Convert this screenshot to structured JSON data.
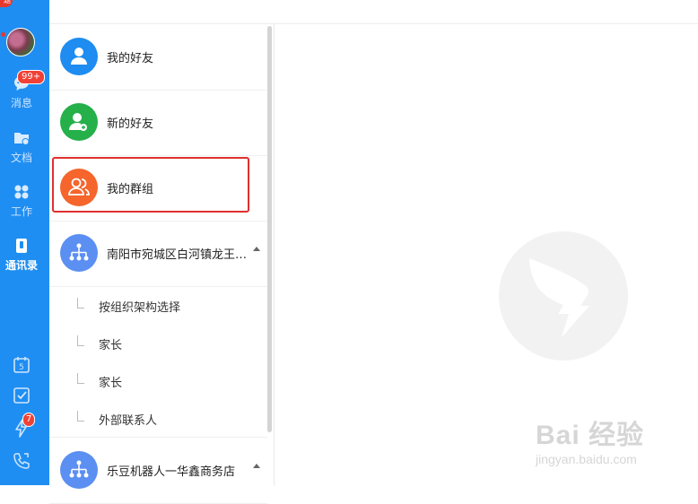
{
  "sidebar": {
    "corner_badge": "题",
    "nav": [
      {
        "label": "消息",
        "icon": "message-icon",
        "badge": "99+"
      },
      {
        "label": "文档",
        "icon": "folder-icon"
      },
      {
        "label": "工作",
        "icon": "apps-icon"
      },
      {
        "label": "通讯录",
        "icon": "contacts-icon",
        "active": true
      }
    ],
    "bottom_icons": [
      {
        "icon": "calendar-icon",
        "text": "5"
      },
      {
        "icon": "todo-check-icon"
      },
      {
        "icon": "ding-lightning-icon",
        "badge": "7"
      },
      {
        "icon": "phone-icon"
      }
    ]
  },
  "contacts": {
    "items": [
      {
        "label": "我的好友",
        "icon": "person-icon",
        "color": "#1e8cf0"
      },
      {
        "label": "新的好友",
        "icon": "add-person-icon",
        "color": "#25b04a"
      },
      {
        "label": "我的群组",
        "icon": "group-icon",
        "color": "#f5652c"
      }
    ],
    "orgs": [
      {
        "label": "南阳市宛城区白河镇龙王…",
        "icon": "org-tree-icon",
        "color": "#5b8ff2",
        "children": [
          "按组织架构选择",
          "家长",
          "家长",
          "外部联系人"
        ]
      },
      {
        "label": "乐豆机器人一华鑫商务店",
        "icon": "org-tree-icon",
        "color": "#5b8ff2"
      }
    ]
  },
  "watermark": {
    "big": "Bai  经验",
    "small": "jingyan.baidu.com"
  },
  "colors": {
    "rail": "#1f8ef2",
    "highlight_border": "#e02f2f"
  }
}
